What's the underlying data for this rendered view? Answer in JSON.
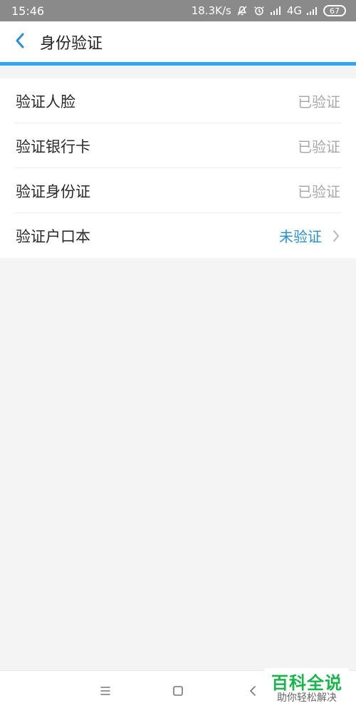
{
  "status_bar": {
    "time": "15:46",
    "network_speed": "18.3K/s",
    "network_type": "4G",
    "battery": "67"
  },
  "header": {
    "title": "身份验证"
  },
  "verification": {
    "items": [
      {
        "label": "验证人脸",
        "status": "已验证"
      },
      {
        "label": "验证银行卡",
        "status": "已验证"
      },
      {
        "label": "验证身份证",
        "status": "已验证"
      },
      {
        "label": "验证户口本",
        "status": "未验证"
      }
    ]
  },
  "watermark": {
    "title": "百科全说",
    "subtitle": "助你轻松解决"
  },
  "colors": {
    "accent": "#2EA7F0",
    "pending_status": "#2B8FD6",
    "verified_status": "#A8A8A8"
  },
  "icons": {
    "back": "chevron-left-icon",
    "row_action": "chevron-right-icon",
    "menu": "menu-icon",
    "home": "home-square-icon",
    "back_nav": "back-triangle-icon"
  }
}
